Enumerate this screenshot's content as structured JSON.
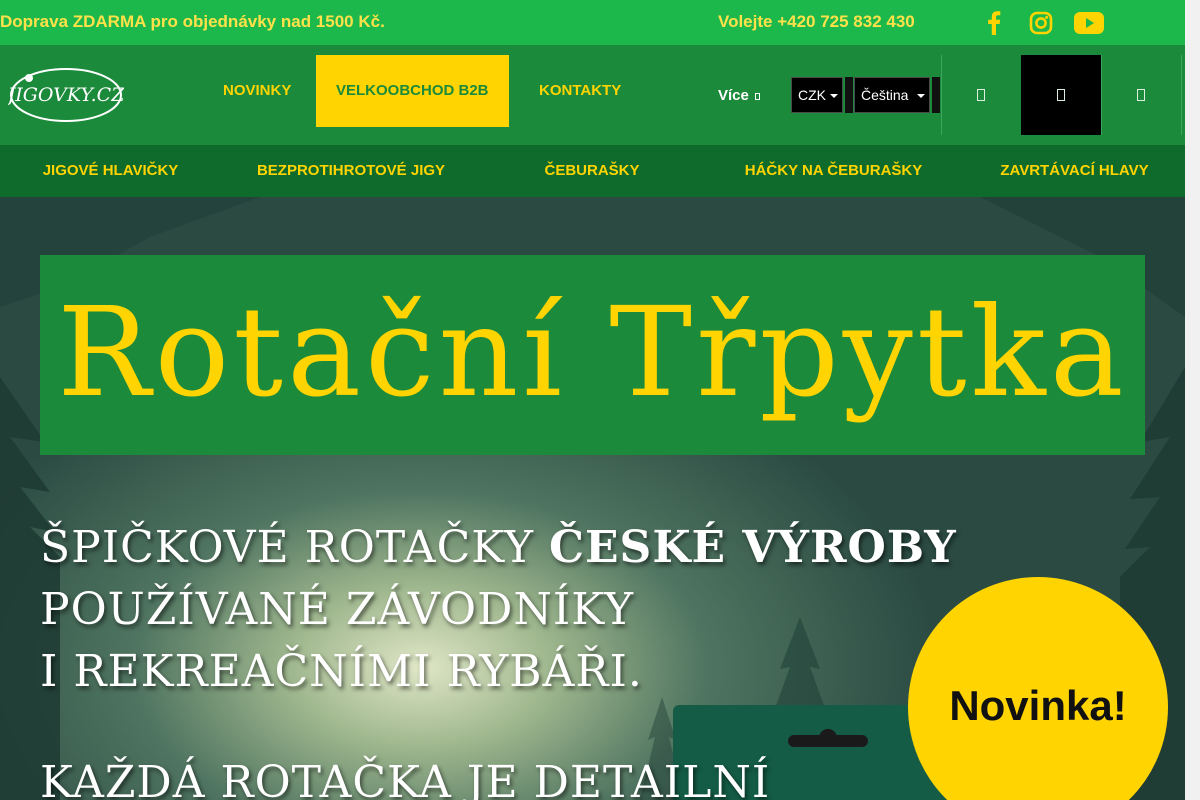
{
  "topbar": {
    "shipping_text": "Doprava ZDARMA pro objednávky nad 1500 Kč.",
    "phone_text": "Volejte +420 725 832 430",
    "social": [
      "facebook-icon",
      "instagram-icon",
      "youtube-icon"
    ]
  },
  "header": {
    "logo_text": "JIGOVKY.CZ",
    "nav": [
      {
        "label": "NOVINKY",
        "active": false
      },
      {
        "label": "VELKOOBCHOD B2B",
        "active": true
      },
      {
        "label": "KONTAKTY",
        "active": false
      }
    ],
    "more_label": "Více",
    "currency_selected": "CZK",
    "language_selected": "Čeština",
    "icon_buttons": [
      "search-icon",
      "user-icon",
      "cart-icon"
    ]
  },
  "categories": [
    "JIGOVÉ HLAVIČKY",
    "BEZPROTIHROTOVÉ JIGY",
    "ČEBURAŠKY",
    "HÁČKY NA ČEBURAŠKY",
    "ZAVRTÁVACÍ HLAVY"
  ],
  "hero": {
    "banner_title": "Rotační Třpytka",
    "line1_regular": "ŠPIČKOVÉ ROTAČKY ",
    "line1_bold": "ČESKÉ VÝROBY",
    "line2": "POUŽÍVANÉ ZÁVODNÍKY",
    "line3": "I REKREAČNÍMI RYBÁŘI.",
    "line4": "KAŽDÁ ROTAČKA JE DETAILNÍ",
    "badge_text": "Novinka!"
  },
  "colors": {
    "topbar_green": "#1cb84b",
    "header_green": "#1b8a3a",
    "category_green": "#0f6b2c",
    "accent_yellow": "#ffd400"
  }
}
